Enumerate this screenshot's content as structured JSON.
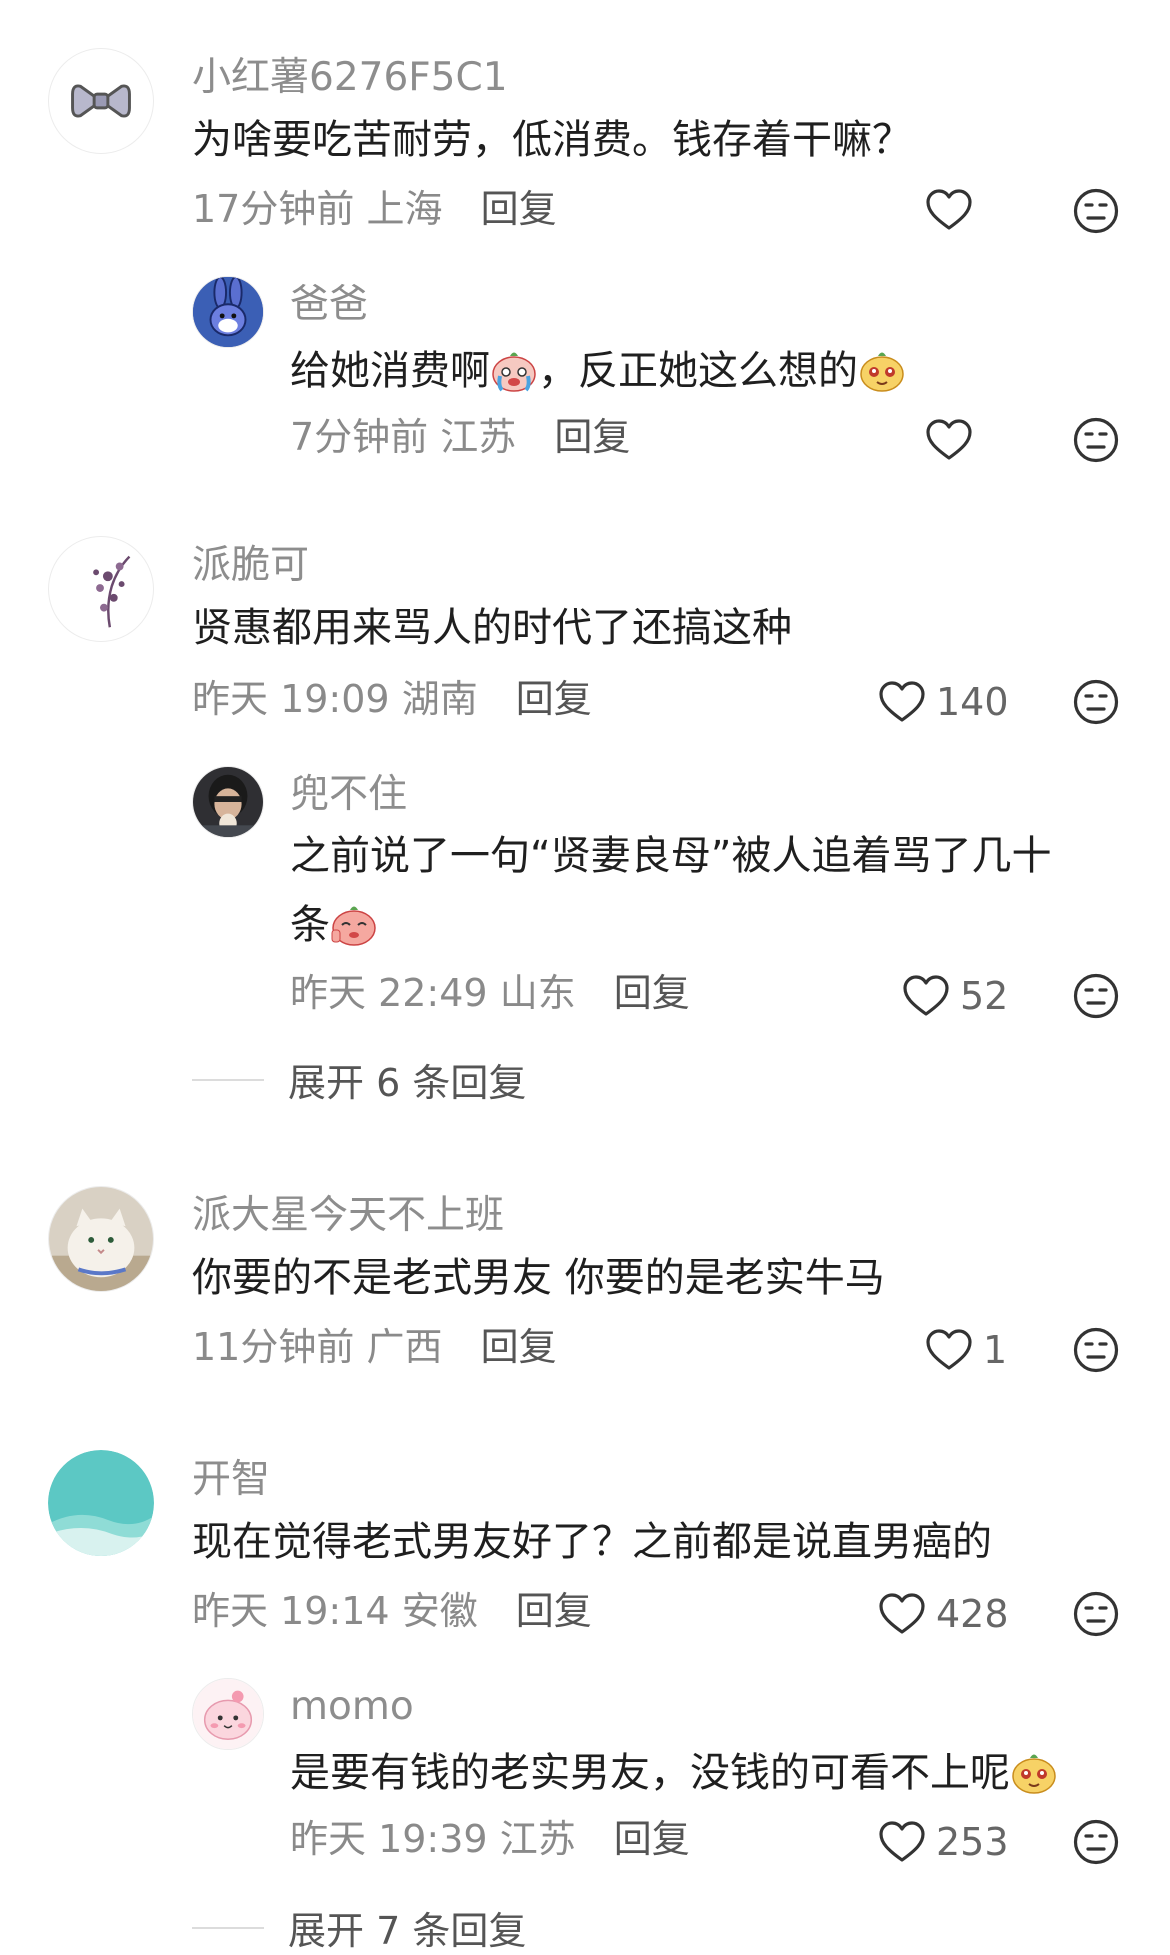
{
  "comments": [
    {
      "user": "小红薯6276F5C1",
      "text": "为啥要吃苦耐劳，低消费。钱存着干嘛？",
      "time": "17分钟前",
      "location": "上海",
      "reply_label": "回复",
      "likes": "",
      "avatar_icon": "bow-icon",
      "replies": [
        {
          "user": "爸爸",
          "text_before": "给她消费啊",
          "text_middle": "，反正她这么想的",
          "emoji_1": "crying-face-emoji",
          "emoji_2": "smug-face-emoji",
          "time": "7分钟前",
          "location": "江苏",
          "reply_label": "回复",
          "likes": "",
          "avatar_icon": "cartoon-rabbit-icon"
        }
      ]
    },
    {
      "user": "派脆可",
      "text": "贤惠都用来骂人的时代了还搞这种",
      "time": "昨天 19:09",
      "location": "湖南",
      "reply_label": "回复",
      "likes": "140",
      "avatar_icon": "flower-branch-icon",
      "replies": [
        {
          "user": "兜不住",
          "text_line1": "之前说了一句“贤妻良母”被人追着骂了几十",
          "text_line2": "条",
          "emoji_1": "waving-face-emoji",
          "time": "昨天 22:49",
          "location": "山东",
          "reply_label": "回复",
          "likes": "52",
          "avatar_icon": "person-photo-icon"
        }
      ],
      "expand_label": "展开 6 条回复"
    },
    {
      "user": "派大星今天不上班",
      "text": "你要的不是老式男友 你要的是老实牛马",
      "time": "11分钟前",
      "location": "广西",
      "reply_label": "回复",
      "likes": "1",
      "avatar_icon": "white-cat-icon"
    },
    {
      "user": "开智",
      "text": "现在觉得老式男友好了？之前都是说直男癌的",
      "time": "昨天 19:14",
      "location": "安徽",
      "reply_label": "回复",
      "likes": "428",
      "avatar_icon": "teal-wave-icon",
      "replies": [
        {
          "user": "momo",
          "text_before": "是要有钱的老实男友，没钱的可看不上呢",
          "emoji_1": "smug-face-emoji",
          "time": "昨天 19:39",
          "location": "江苏",
          "reply_label": "回复",
          "likes": "253",
          "avatar_icon": "pink-character-icon"
        }
      ],
      "expand_label": "展开 7 条回复"
    }
  ],
  "colors": {
    "username": "#8d8d8d",
    "text": "#1f1f1f",
    "meta": "#8a8a8a",
    "icon_stroke": "#333333"
  }
}
